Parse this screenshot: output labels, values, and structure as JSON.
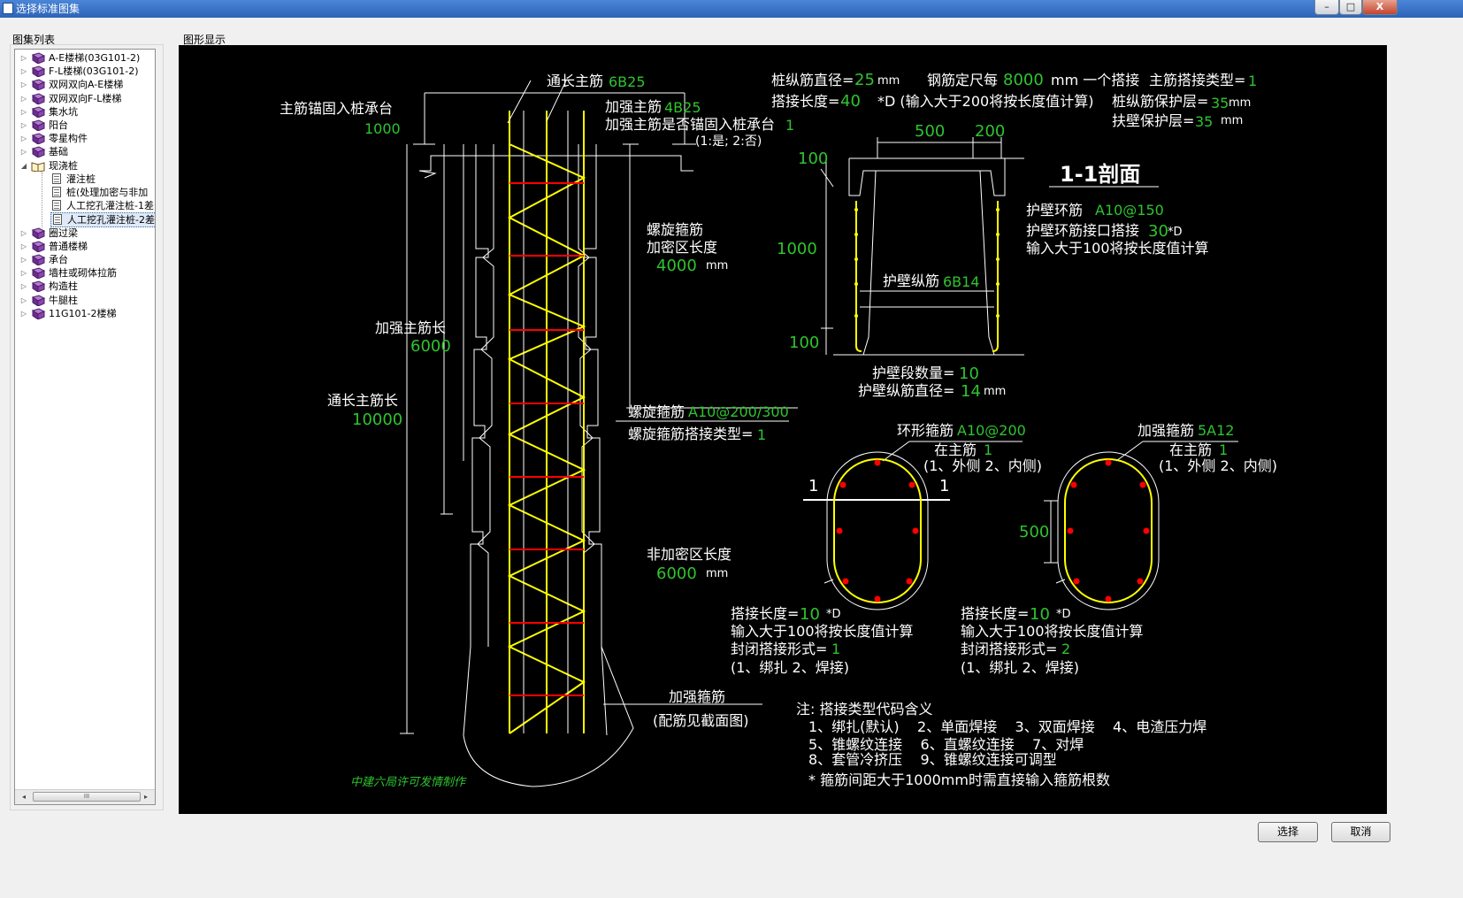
{
  "window": {
    "title": "选择标准图集",
    "controls": [
      "–",
      "□",
      "X"
    ]
  },
  "labels": {
    "tree_panel": "图集列表",
    "graphic_panel": "图形显示"
  },
  "tree": {
    "items": [
      {
        "label": "A-E楼梯(03G101-2)",
        "level": 0,
        "icon": "book-icon",
        "expander": "▷"
      },
      {
        "label": "F-L楼梯(03G101-2)",
        "level": 0,
        "icon": "book-icon",
        "expander": "▷"
      },
      {
        "label": "双网双向A-E楼梯",
        "level": 0,
        "icon": "book-icon",
        "expander": "▷"
      },
      {
        "label": "双网双向F-L楼梯",
        "level": 0,
        "icon": "book-icon",
        "expander": "▷"
      },
      {
        "label": "集水坑",
        "level": 0,
        "icon": "book-icon",
        "expander": "▷"
      },
      {
        "label": "阳台",
        "level": 0,
        "icon": "book-icon",
        "expander": "▷"
      },
      {
        "label": "零星构件",
        "level": 0,
        "icon": "book-icon",
        "expander": "▷"
      },
      {
        "label": "基础",
        "level": 0,
        "icon": "book-icon",
        "expander": "▷"
      },
      {
        "label": "现浇桩",
        "level": 0,
        "icon": "open-book-icon",
        "expander": "◢"
      },
      {
        "label": "灌注桩",
        "level": 1,
        "icon": "document-icon"
      },
      {
        "label": "桩(处理加密与非加",
        "level": 1,
        "icon": "document-icon"
      },
      {
        "label": "人工挖孔灌注桩-1差",
        "level": 1,
        "icon": "document-icon"
      },
      {
        "label": "人工挖孔灌注桩-2差",
        "level": 1,
        "icon": "document-icon",
        "selected": true
      },
      {
        "label": "圈过梁",
        "level": 0,
        "icon": "book-icon",
        "expander": "▷"
      },
      {
        "label": "普通楼梯",
        "level": 0,
        "icon": "book-icon",
        "expander": "▷"
      },
      {
        "label": "承台",
        "level": 0,
        "icon": "book-icon",
        "expander": "▷"
      },
      {
        "label": "墙柱或砌体拉筋",
        "level": 0,
        "icon": "book-icon",
        "expander": "▷"
      },
      {
        "label": "构造柱",
        "level": 0,
        "icon": "book-icon",
        "expander": "▷"
      },
      {
        "label": "牛腿柱",
        "level": 0,
        "icon": "book-icon",
        "expander": "▷"
      },
      {
        "label": "11G101-2楼梯",
        "level": 0,
        "icon": "book-icon",
        "expander": "▷"
      }
    ],
    "scroll_left": "◂",
    "scroll_right": "▸",
    "scroll_thumb": "III"
  },
  "drawing": {
    "colors": {
      "white": "#ffffff",
      "green": "#2ec42e",
      "yellow": "#ffff00",
      "red": "#ff0000",
      "bg": "#000000"
    },
    "left": {
      "anchor_label": "主筋锚固入桩承台",
      "anchor_value": "1000",
      "through_bar_label": "通长主筋",
      "through_bar_value": "6B25",
      "strong_bar_label": "加强主筋",
      "strong_bar_value": "4B25",
      "anchor_question": "加强主筋是否锚固入桩承台",
      "anchor_question_value": "1",
      "anchor_options": "(1:是; 2:否)",
      "spiral_label_1": "螺旋箍筋",
      "spiral_label_2": "加密区长度",
      "spiral_dense_value": "4000",
      "unit_mm": "mm",
      "strong_len_label": "加强主筋长",
      "strong_len_value": "6000",
      "through_len_label": "通长主筋长",
      "through_len_value": "10000",
      "spiral_bar_label": "螺旋箍筋",
      "spiral_bar_value": "A10@200/300",
      "spiral_lap_label": "螺旋箍筋搭接类型=",
      "spiral_lap_value": "1",
      "nondense_label": "非加密区长度",
      "nondense_value": "6000",
      "strong_hoop_label": "加强箍筋",
      "strong_hoop_note": "(配筋见截面图)",
      "credit": "中建六局许可发情制作"
    },
    "top_params": {
      "pile_dia_label": "桩纵筋直径=",
      "pile_dia_value": "25",
      "pile_dia_unit": "mm",
      "fixed_len_label": "钢筋定尺每",
      "fixed_len_value": "8000",
      "fixed_len_suffix": "mm 一个搭接",
      "lap_type_label": "主筋搭接类型=",
      "lap_type_value": "1",
      "lap_len_label": "搭接长度=",
      "lap_len_value": "40",
      "lap_len_note": "*D (输入大于200将按长度值计算)",
      "cover_label": "桩纵筋保护层=",
      "cover_value": "35",
      "cover_unit": "mm",
      "wall_cover_label": "扶壁保护层=",
      "wall_cover_value": "35",
      "wall_cover_unit": "mm"
    },
    "section": {
      "dim_500": "500",
      "dim_200": "200",
      "dim_100_top": "100",
      "dim_1000": "1000",
      "dim_100_bot": "100",
      "title": "1-1剖面",
      "ring_label": "护壁环筋",
      "ring_value": "A10@150",
      "ring_lap_label": "护壁环筋接口搭接",
      "ring_lap_value": "30",
      "ring_lap_unit": "*D",
      "ring_lap_note": "输入大于100将按长度值计算",
      "long_bar_label": "护壁纵筋",
      "long_bar_value": "6B14",
      "seg_count_label": "护壁段数量=",
      "seg_count_value": "10",
      "long_dia_label": "护壁纵筋直径=",
      "long_dia_value": "14",
      "long_dia_unit": "mm"
    },
    "circle1": {
      "hoop_label": "环形箍筋",
      "hoop_value": "A10@200",
      "pos_label": "在主筋",
      "pos_value": "1",
      "pos_options": "(1、外侧  2、内侧)",
      "cut_label_left": "1",
      "cut_label_right": "1",
      "lap_label": "搭接长度=",
      "lap_value": "10",
      "lap_unit": "*D",
      "lap_note": "输入大于100将按长度值计算",
      "close_label": "封闭搭接形式=",
      "close_value": "1",
      "close_options": "(1、绑扎  2、焊接)"
    },
    "circle2": {
      "hoop_label": "加强箍筋",
      "hoop_value": "5A12",
      "pos_label": "在主筋",
      "pos_value": "1",
      "pos_options": "(1、外侧  2、内侧)",
      "dim_500": "500",
      "lap_label": "搭接长度=",
      "lap_value": "10",
      "lap_unit": "*D",
      "lap_note": "输入大于100将按长度值计算",
      "close_label": "封闭搭接形式=",
      "close_value": "2",
      "close_options": "(1、绑扎  2、焊接)"
    },
    "notes": {
      "title": "注: 搭接类型代码含义",
      "line1": "1、绑扎(默认)    2、单面焊接    3、双面焊接    4、电渣压力焊",
      "line2": "5、锥螺纹连接    6、直螺纹连接    7、对焊",
      "line3": "8、套管冷挤压    9、锥螺纹连接可调型",
      "line4": "* 箍筋间距大于1000mm时需直接输入箍筋根数"
    }
  },
  "buttons": {
    "select": "选择",
    "cancel": "取消"
  }
}
